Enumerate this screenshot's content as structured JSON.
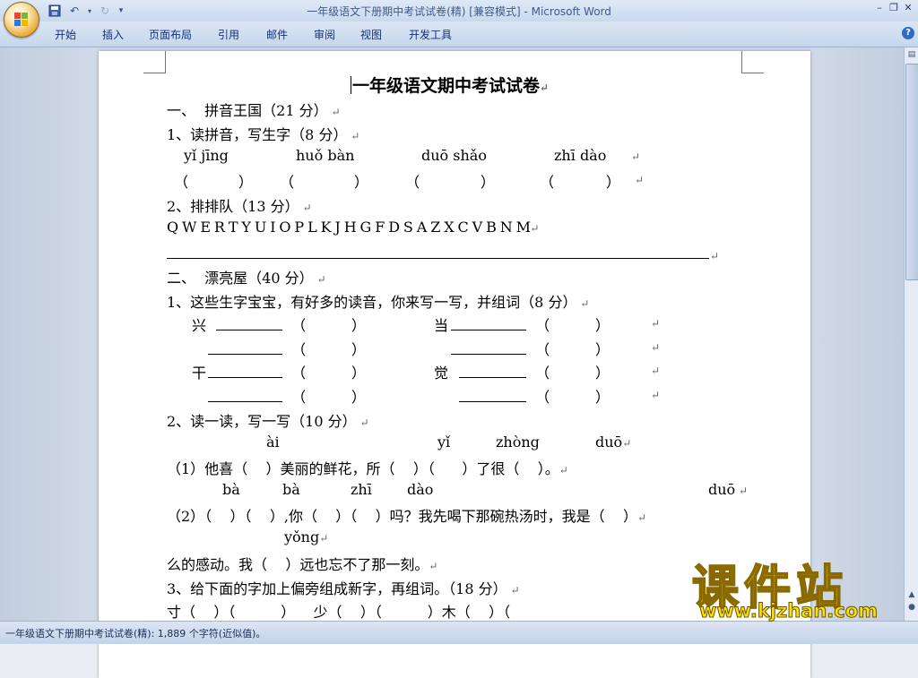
{
  "window": {
    "doc_name": "一年级语文下册期中考试试卷(精) [兼容模式] - ",
    "app_name": "Microsoft Word"
  },
  "ribbon_tabs": [
    "开始",
    "插入",
    "页面布局",
    "引用",
    "邮件",
    "审阅",
    "视图",
    "开发工具"
  ],
  "doc": {
    "title": "一年级语文期中考试试卷",
    "sec1": "一、  拼音王国（21 分）",
    "q1": "1、读拼音，写生字（8 分）",
    "q1_py": [
      "yǐ jīng",
      "huǒ bàn",
      "duō shǎo",
      "zhī dào"
    ],
    "q1_paren": [
      "（",
      "）",
      "（",
      "）",
      "（",
      "）",
      "（",
      "）"
    ],
    "q2": "2、排排队（13 分）",
    "q2_letters": "Q W E R T Y U I O P L K J H G F D S A Z X C V B N M",
    "sec2": "二、  漂亮屋（40 分）",
    "q3": "1、这些生字宝宝，有好多的读音，你来写一写，并组词（8 分）",
    "char_xing": "兴",
    "char_dang": "当",
    "char_gan": "干",
    "char_jue": "觉",
    "q4": "2、读一读，写一写（10 分）",
    "py_ai": "ài",
    "py_yi": "yǐ",
    "py_zhong": "zhòng",
    "py_duo": "duō",
    "s1": "（1）他喜（    ）美丽的鲜花，所（    ）（      ）了很（    ）。",
    "py_ba1": "bà",
    "py_ba2": "bà",
    "py_zhi": "zhī",
    "py_dao": "dào",
    "py_duo2": "duō",
    "s2": "（2）（    ）（    ）,你（    ）（    ）吗？我先喝下那碗热汤时，我是（    ）",
    "py_yong": "yǒng",
    "s3": "么的感动。我（    ）远也忘不了那一刻。",
    "q5": "3、给下面的字加上偏旁组成新字，再组词。（18 分）",
    "s4": "寸（    ）（          ）    少（    ）（          ）木（    ）（"
  },
  "status": "一年级语文下册期中考试试卷(精): 1,889 个字符(近似值)。",
  "watermark": {
    "cn": "课件站",
    "url": "www.kjzhan.com"
  }
}
